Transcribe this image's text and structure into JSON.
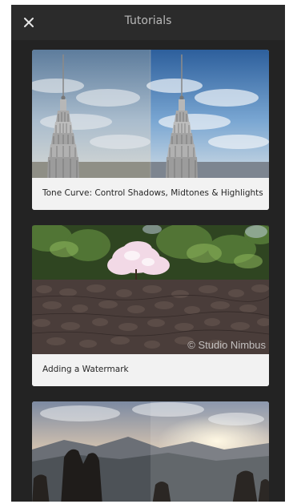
{
  "header": {
    "title": "Tutorials"
  },
  "tutorials": [
    {
      "title": "Tone Curve: Control Shadows, Midtones & Highlights"
    },
    {
      "title": "Adding a Watermark",
      "watermark_text": "© Studio Nimbus"
    },
    {
      "title": ""
    }
  ]
}
